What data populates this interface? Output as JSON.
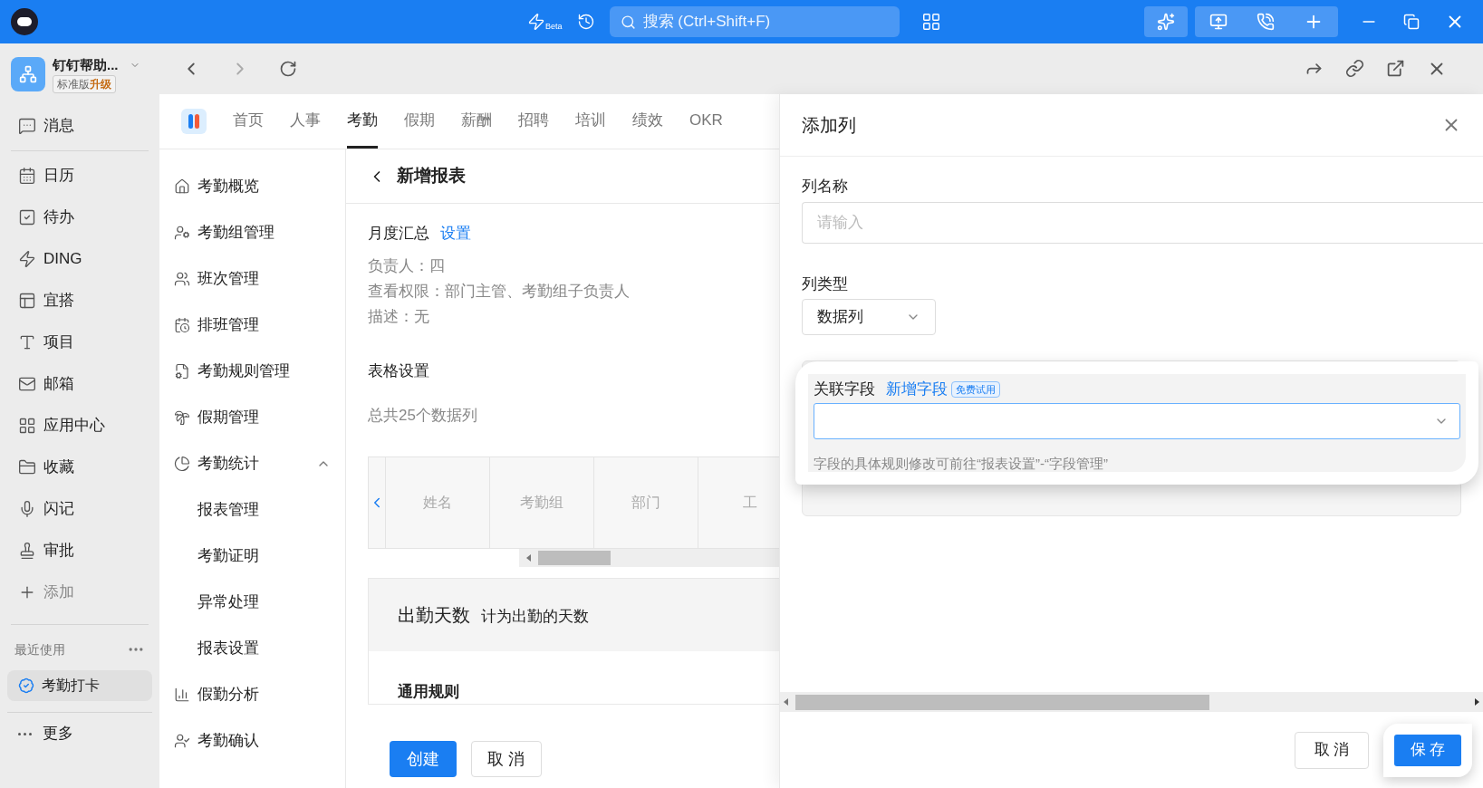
{
  "title_bar": {
    "beta_label": "Beta",
    "search_placeholder": "搜索 (Ctrl+Shift+F)"
  },
  "sidebar": {
    "workspace": {
      "name": "钉钉帮助...",
      "edition": "标准版",
      "upgrade": "升级"
    },
    "items": [
      {
        "label": "消息"
      },
      {
        "label": "日历"
      },
      {
        "label": "待办"
      },
      {
        "label": "DING"
      },
      {
        "label": "宜搭"
      },
      {
        "label": "项目"
      },
      {
        "label": "邮箱"
      },
      {
        "label": "应用中心"
      },
      {
        "label": "收藏"
      },
      {
        "label": "闪记"
      },
      {
        "label": "审批"
      },
      {
        "label": "添加"
      }
    ],
    "recent": {
      "label": "最近使用",
      "items": [
        {
          "label": "考勤打卡",
          "selected": true
        }
      ]
    },
    "more": "更多"
  },
  "app_tabs": [
    {
      "label": "首页",
      "selected": false
    },
    {
      "label": "人事",
      "selected": false
    },
    {
      "label": "考勤",
      "selected": true
    },
    {
      "label": "假期",
      "selected": false
    },
    {
      "label": "薪酬",
      "selected": false
    },
    {
      "label": "招聘",
      "selected": false
    },
    {
      "label": "培训",
      "selected": false
    },
    {
      "label": "绩效",
      "selected": false
    },
    {
      "label": "OKR",
      "selected": false
    }
  ],
  "left_nav": [
    {
      "label": "考勤概览"
    },
    {
      "label": "考勤组管理"
    },
    {
      "label": "班次管理"
    },
    {
      "label": "排班管理"
    },
    {
      "label": "考勤规则管理"
    },
    {
      "label": "假期管理"
    },
    {
      "label": "考勤统计",
      "expanded": true,
      "children": [
        {
          "label": "报表管理"
        },
        {
          "label": "考勤证明"
        },
        {
          "label": "异常处理"
        },
        {
          "label": "报表设置"
        }
      ]
    },
    {
      "label": "假勤分析"
    },
    {
      "label": "考勤确认"
    }
  ],
  "report": {
    "title": "新增报表",
    "summary_name": "月度汇总",
    "settings_link": "设置",
    "details": [
      "负责人：四",
      "查看权限：部门主管、考勤组子负责人",
      "描述：无"
    ],
    "table_settings": "表格设置",
    "column_count": "总共25个数据列",
    "table_columns": [
      "姓名",
      "考勤组",
      "部门",
      "工"
    ],
    "rule_card": {
      "title": "出勤天数",
      "description": "计为出勤的天数",
      "section": "通用规则"
    },
    "buttons": [
      {
        "label": "创建",
        "primary": true
      },
      {
        "label": "取 消",
        "primary": false
      }
    ]
  },
  "dialog": {
    "title": "添加列",
    "name_label": "列名称",
    "name_placeholder": "请输入",
    "type_label": "列类型",
    "type_value": "数据列",
    "field_label": "关联字段",
    "add_field_link": "新增字段",
    "trial_badge": "免费试用",
    "hint": "字段的具体规则修改可前往“报表设置”-“字段管理”",
    "buttons": [
      {
        "label": "取 消",
        "primary": false
      },
      {
        "label": "保 存",
        "primary": true
      }
    ]
  }
}
